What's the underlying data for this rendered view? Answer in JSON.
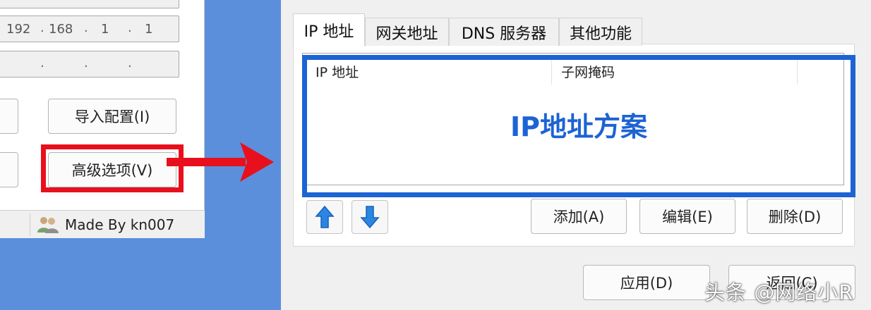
{
  "left_window": {
    "gateway_field": {
      "octets": [
        "192",
        "168",
        "1",
        "1"
      ]
    },
    "import_button": "导入配置(I)",
    "advanced_button": "高级选项(V)",
    "status_text": "Made By kn007"
  },
  "right_window": {
    "tabs": [
      {
        "label": "IP 地址",
        "active": true
      },
      {
        "label": "网关地址",
        "active": false
      },
      {
        "label": "DNS 服务器",
        "active": false
      },
      {
        "label": "其他功能",
        "active": false
      }
    ],
    "list_columns": [
      "IP 地址",
      "子网掩码"
    ],
    "callout_label": "IP地址方案",
    "add_button": "添加(A)",
    "edit_button": "编辑(E)",
    "delete_button": "删除(D)",
    "apply_button": "应用(D)",
    "return_button": "返回(C)"
  },
  "watermark": "头条 @网络小R",
  "colors": {
    "desktop": "#5b8fdc",
    "red_highlight": "#e8101c",
    "blue_highlight": "#1c63d4",
    "arrow_blue": "#2a86e2"
  },
  "icons": {
    "move_up": "arrow-up-icon",
    "move_down": "arrow-down-icon",
    "status": "users-icon"
  }
}
